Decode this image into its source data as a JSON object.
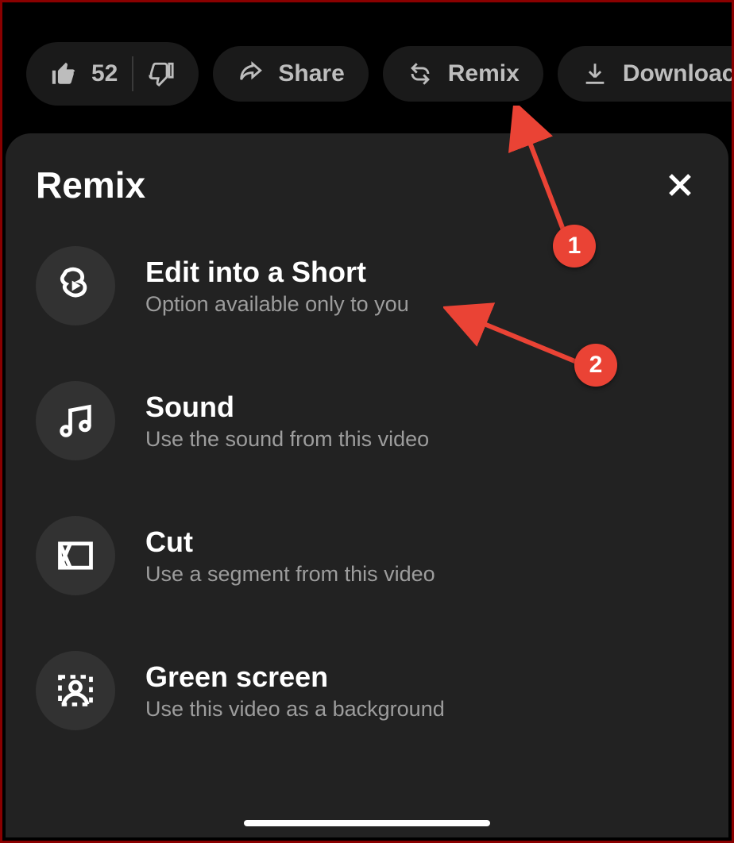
{
  "actions": {
    "like_count": "52",
    "share_label": "Share",
    "remix_label": "Remix",
    "download_label": "Downloac"
  },
  "sheet": {
    "title": "Remix",
    "options": [
      {
        "title": "Edit into a Short",
        "subtitle": "Option available only to you"
      },
      {
        "title": "Sound",
        "subtitle": "Use the sound from this video"
      },
      {
        "title": "Cut",
        "subtitle": "Use a segment from this video"
      },
      {
        "title": "Green screen",
        "subtitle": "Use this video as a background"
      }
    ]
  },
  "annotations": {
    "badge1": "1",
    "badge2": "2"
  }
}
